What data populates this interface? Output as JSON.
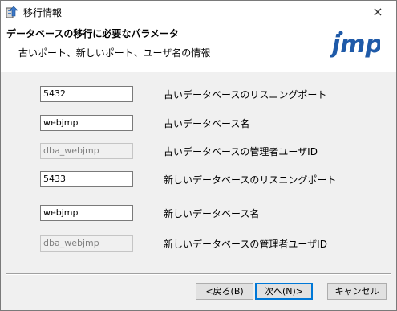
{
  "window": {
    "title": "移行情報",
    "close_icon": "×"
  },
  "header": {
    "title": "データベースの移行に必要なパラメータ",
    "subtitle": "古いポート、新しいポート、ユーザ名の情報",
    "logo_text": "jmp"
  },
  "fields": [
    {
      "value": "5432",
      "label": "古いデータベースのリスニングポート",
      "enabled": true
    },
    {
      "value": "webjmp",
      "label": "古いデータベース名",
      "enabled": true
    },
    {
      "value": "dba_webjmp",
      "label": "古いデータベースの管理者ユーザID",
      "enabled": false
    },
    {
      "value": "5433",
      "label": "新しいデータベースのリスニングポート",
      "enabled": true
    },
    {
      "value": "webjmp",
      "label": "新しいデータベース名",
      "enabled": true
    },
    {
      "value": "dba_webjmp",
      "label": "新しいデータベースの管理者ユーザID",
      "enabled": false
    }
  ],
  "buttons": {
    "back": "<戻る(B)",
    "next": "次へ(N)>",
    "cancel": "キャンセル"
  },
  "colors": {
    "logo_blue": "#1f5aa8",
    "logo_dot": "#1f5aa8"
  }
}
